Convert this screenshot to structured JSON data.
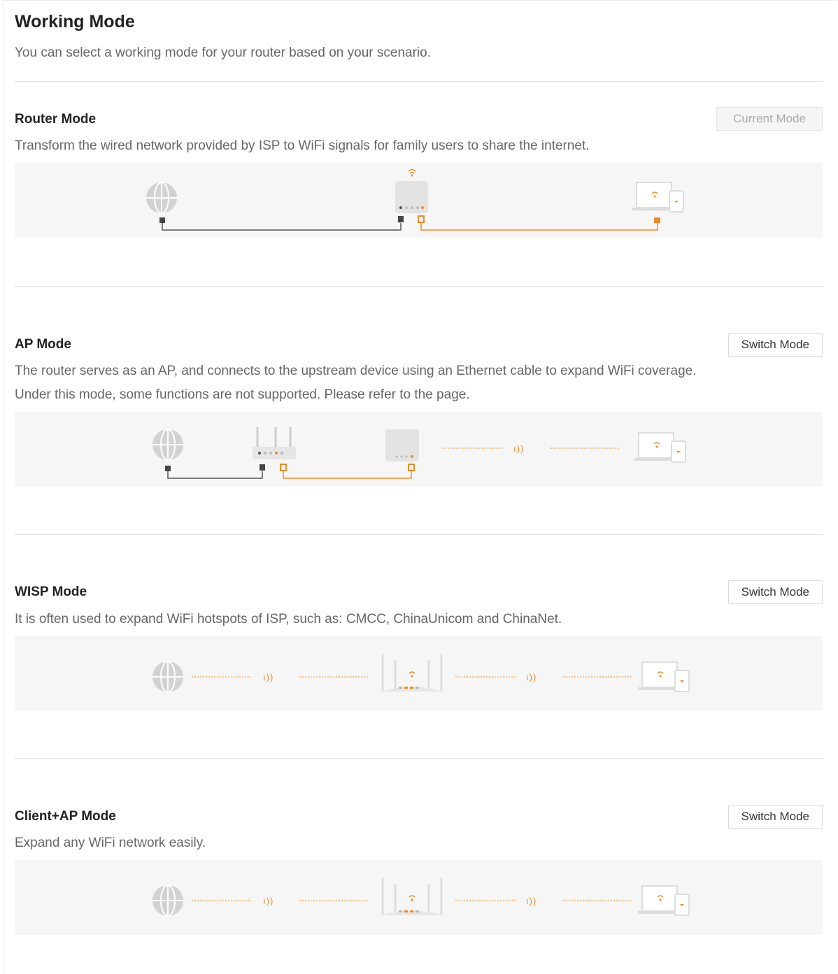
{
  "page": {
    "title": "Working Mode",
    "subtitle": "You can select a working mode for your router based on your scenario."
  },
  "modes": [
    {
      "name": "Router Mode",
      "description": "Transform the wired network provided by ISP to WiFi signals for family users to share the internet.",
      "button_label": "Current Mode",
      "is_current": true
    },
    {
      "name": "AP Mode",
      "description_line1": "The router serves as an AP, and connects to the upstream device using an Ethernet cable to expand WiFi coverage.",
      "description_line2": "Under this mode, some functions are not supported. Please refer to the page.",
      "button_label": "Switch Mode",
      "is_current": false
    },
    {
      "name": "WISP Mode",
      "description": "It is often used to expand WiFi hotspots of ISP, such as: CMCC, ChinaUnicom and ChinaNet.",
      "button_label": "Switch Mode",
      "is_current": false
    },
    {
      "name": "Client+AP Mode",
      "description": "Expand any WiFi network easily.",
      "button_label": "Switch Mode",
      "is_current": false
    }
  ],
  "colors": {
    "accent": "#f08a24",
    "cable_dark": "#555555",
    "device_gray": "#c8c8c8",
    "diagram_bg": "#f6f6f6"
  }
}
